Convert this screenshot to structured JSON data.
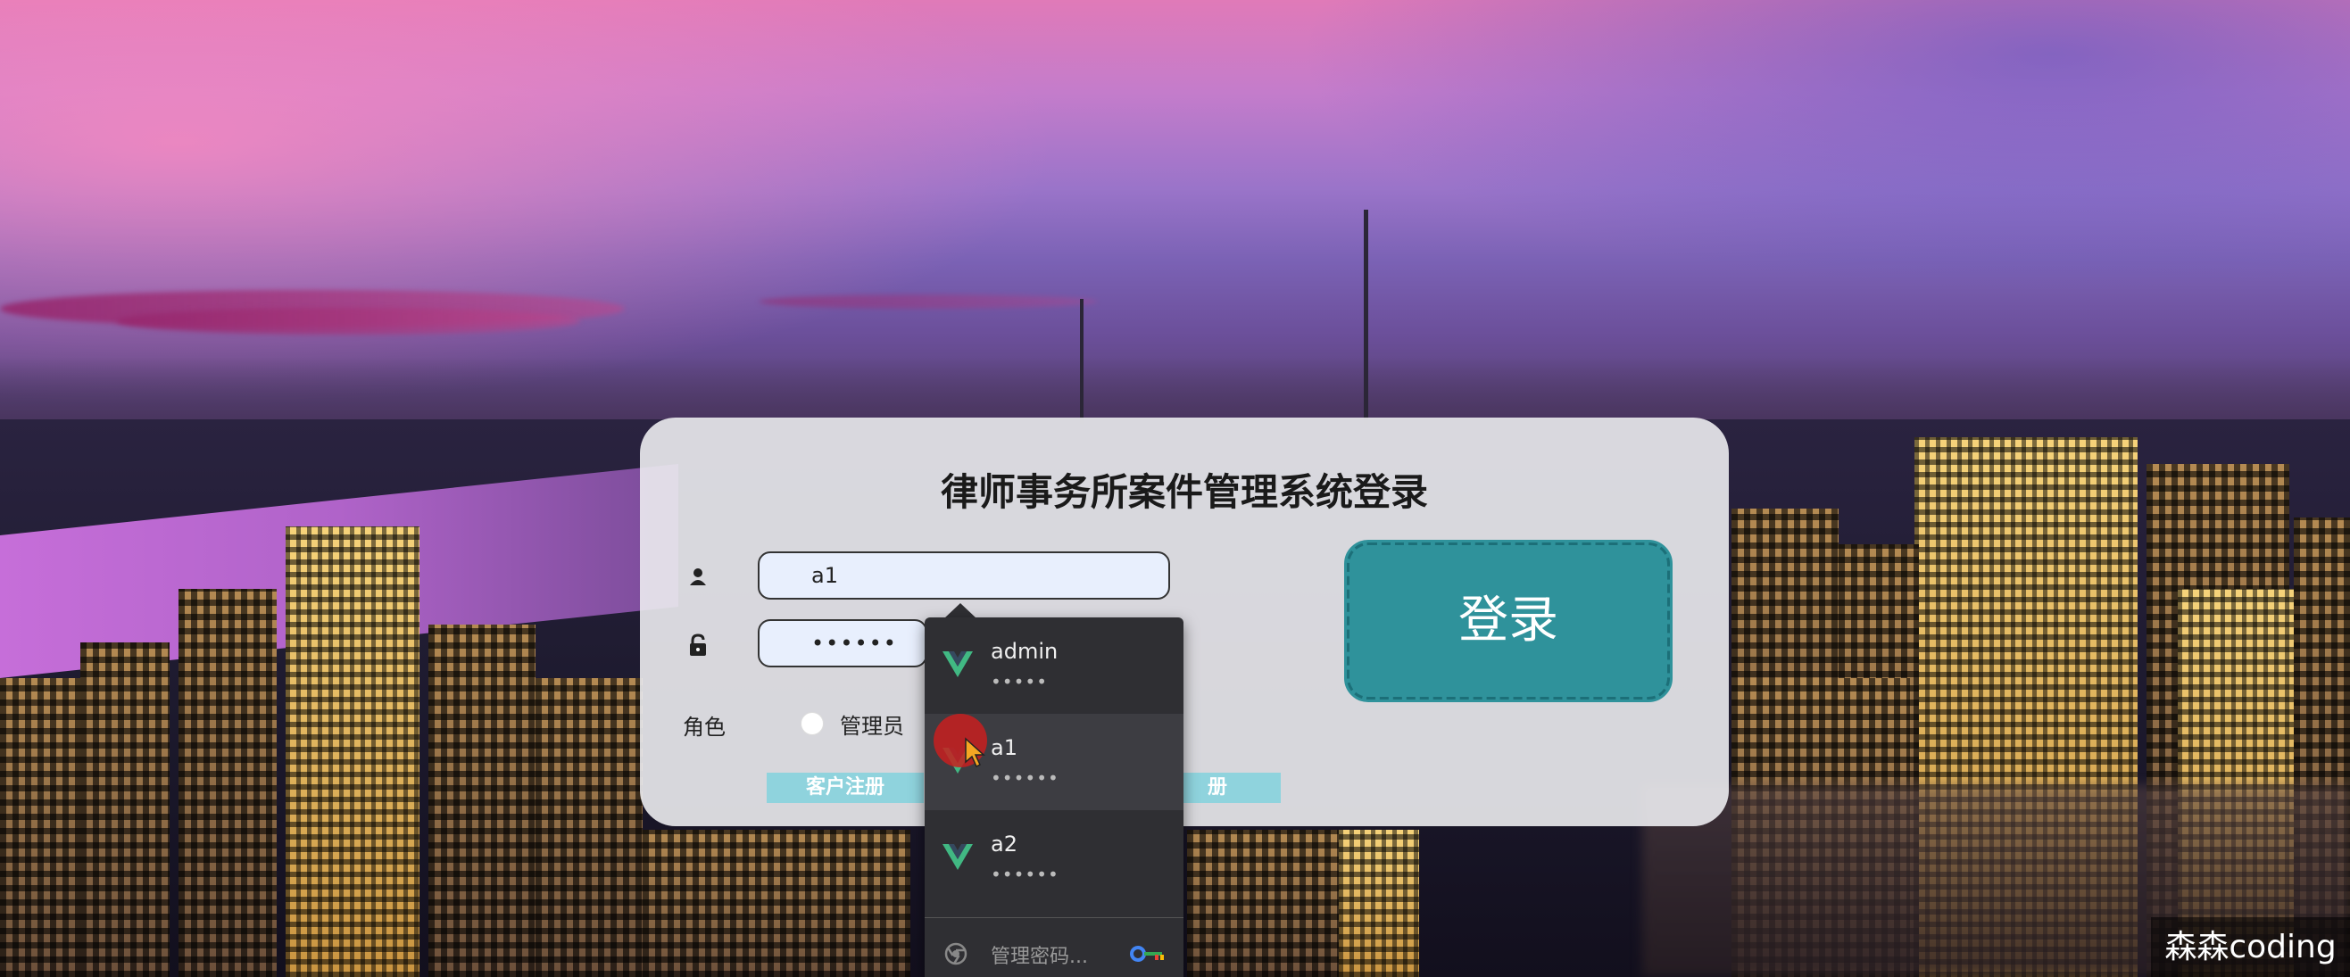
{
  "login": {
    "title": "律师事务所案件管理系统登录",
    "username_value": "a1",
    "password_value": "••••••",
    "role_label": "角色",
    "role_option": "管理员",
    "register_left": "客户注册",
    "register_right": "册",
    "login_button": "登录"
  },
  "autofill": {
    "items": [
      {
        "username": "admin",
        "password": "•••••"
      },
      {
        "username": "a1",
        "password": "••••••"
      },
      {
        "username": "a2",
        "password": "••••••"
      }
    ],
    "manage_label": "管理密码..."
  },
  "watermark": "森森coding",
  "colors": {
    "card_background": "#ececf0",
    "login_button": "#2f929b",
    "register_button": "#8fd3dd",
    "dropdown_background": "#2f2f33",
    "vue_logo": "#41b883"
  }
}
